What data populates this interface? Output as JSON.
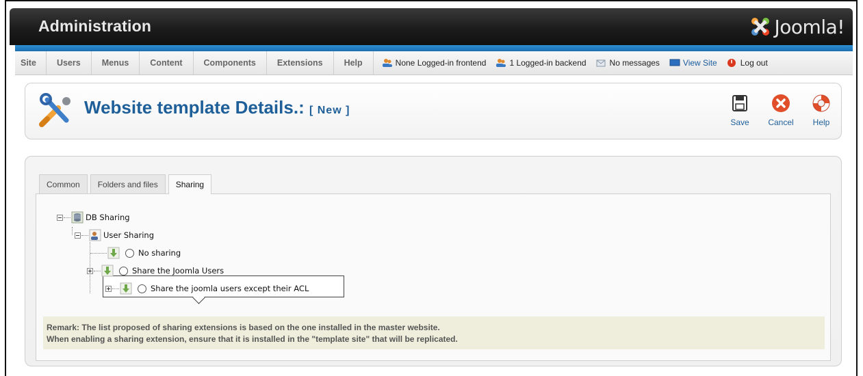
{
  "header": {
    "title": "Administration",
    "logo_text": "Joomla!"
  },
  "menu": {
    "items": [
      "Site",
      "Users",
      "Menus",
      "Content",
      "Components",
      "Extensions",
      "Help"
    ]
  },
  "status": {
    "frontend": "None Logged-in frontend",
    "backend": "1 Logged-in backend",
    "messages": "No messages",
    "view_site": "View Site",
    "logout": "Log out"
  },
  "page": {
    "title": "Website template Details.:",
    "subtitle": "[ New ]"
  },
  "toolbar": {
    "save_label": "Save",
    "cancel_label": "Cancel",
    "help_label": "Help"
  },
  "tabs": [
    {
      "label": "Common",
      "active": false
    },
    {
      "label": "Folders and files",
      "active": false
    },
    {
      "label": "Sharing",
      "active": true
    }
  ],
  "tree": {
    "root_label": "DB Sharing",
    "child_label": "User Sharing",
    "options": [
      {
        "label": "No sharing"
      },
      {
        "label": "Share the Joomla Users"
      },
      {
        "label": "Share the joomla users except their ACL"
      }
    ]
  },
  "remark": {
    "line1": "Remark: The list proposed of sharing extensions is based on the one installed in the master website.",
    "line2": "When enabling a sharing extension, ensure that it is installed in the \"template site\" that will be replicated."
  },
  "colors": {
    "header_bg": "#1c1c1c",
    "accent_blue": "#1a6fb0",
    "title_blue": "#1e5f99",
    "remark_bg": "#efeedc"
  }
}
